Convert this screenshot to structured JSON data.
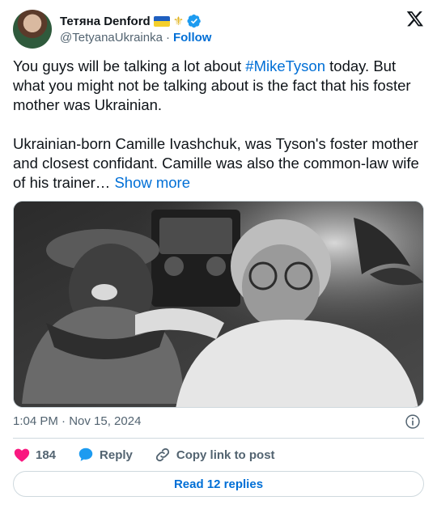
{
  "author": {
    "name": "Тетяна Denford",
    "handle": "@TetyanaUkrainka",
    "separator": "·",
    "follow_label": "Follow",
    "emoji_flag": "ukraine-flag",
    "emoji_symbol": "⚜"
  },
  "tweet": {
    "line1_before": "You guys will be talking a lot about ",
    "hashtag": "#MikeTyson",
    "line1_after": " today. But what you might not be talking about is the fact that his foster mother was Ukrainian.",
    "paragraph2": "Ukrainian-born Camille Ivashchuk, was Tyson's foster mother and closest confidant. Camille was also the common-law wife of his trainer… ",
    "show_more": "Show more"
  },
  "meta": {
    "timestamp": "1:04 PM · Nov 15, 2024"
  },
  "actions": {
    "like_count": "184",
    "reply_label": "Reply",
    "copy_label": "Copy link to post"
  },
  "footer": {
    "read_replies": "Read 12 replies"
  },
  "colors": {
    "accent": "#006fd6",
    "like": "#f91880",
    "reply": "#1d9bf0",
    "verified": "#1d9bf0",
    "muted": "#536471",
    "border": "#cfd9de"
  }
}
